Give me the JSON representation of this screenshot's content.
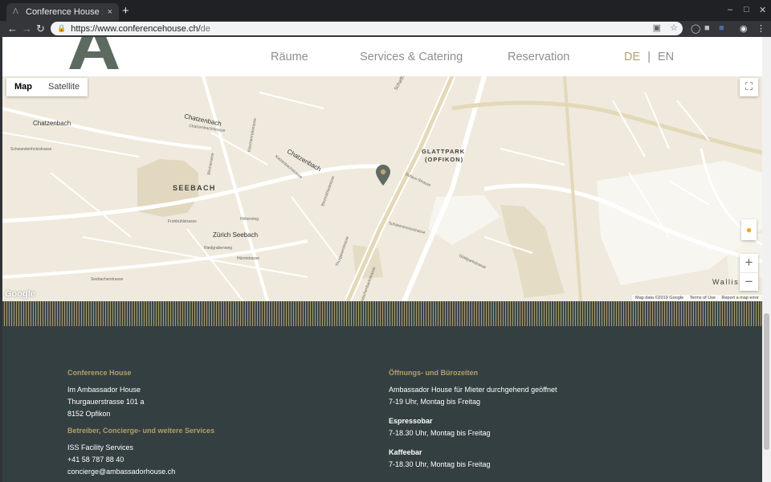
{
  "browser": {
    "tab_title": "Conference House : Ambass",
    "tab_close": "×",
    "new_tab": "+",
    "url_host": "https://www.conferencehouse.ch/",
    "url_path": "de",
    "window_min": "–",
    "window_max": "□",
    "window_close": "✕"
  },
  "header": {
    "logo_letter": "A",
    "nav": [
      "Räume",
      "Services & Catering",
      "Reservation"
    ],
    "lang_active": "DE",
    "lang_separator": "|",
    "lang_other": "EN"
  },
  "map": {
    "type_map": "Map",
    "type_satellite": "Satellite",
    "zoom_in": "+",
    "zoom_out": "−",
    "google_logo": "Google",
    "attribution": "Map data ©2019 Google",
    "terms": "Terms of Use",
    "report": "Report a map error",
    "labels": {
      "seebach": "SEEBACH",
      "glattpark_1": "GLATTPARK",
      "glattpark_2": "(OPFIKON)",
      "chatzenbach_left": "Chatzenbach",
      "chatzenbach_mid": "Chatzenbach",
      "chatzenbach_center": "Chatzenbach",
      "zuerich_seebach": "Zürich Seebach",
      "wallisellen": "Wallis",
      "schaffhauserstrasse": "Schaffha",
      "streets": [
        "Schwandenholzstrasse",
        "Chatzenbachstrasse",
        "Dufaux-Strasse",
        "Glattparkstrasse",
        "Schärenmoosstrasse",
        "Thurgauerstrasse",
        "Leutschenbachstrasse",
        "Hürststrasse",
        "Binzmühlestrasse",
        "Riedgrabenweg",
        "Frohbühlstrasse",
        "Birchstrasse",
        "Köschenrütistrasse",
        "Katzenbachstrasse",
        "Höhenring",
        "Seebacherstrasse"
      ]
    }
  },
  "footer": {
    "col1": {
      "heading": "Conference House",
      "lines": [
        "Im Ambassador House",
        "Thurgauerstrasse 101 a",
        "8152 Opfikon"
      ],
      "heading2": "Betreiber, Concierge- und weitere Services",
      "lines2": [
        "ISS Facility Services",
        "+41 58 787 88 40",
        "concierge@ambassadorhouse.ch"
      ]
    },
    "col2": {
      "heading": "Öffnungs- und Bürozeiten",
      "lines": [
        "Ambassador House für Mieter durchgehend geöffnet",
        "7-19 Uhr, Montag bis Freitag"
      ],
      "espresso_title": "Espressobar",
      "espresso_hours": "7-18.30 Uhr, Montag bis Freitag",
      "kaffee_title": "Kaffeebar",
      "kaffee_hours": "7-18.30 Uhr, Montag bis Freitag"
    }
  },
  "colors": {
    "accent_gold": "#b7a069",
    "footer_bg": "#343f42",
    "map_bg": "#efeadd",
    "marker": "#5f6a62"
  },
  "icons": [
    "back-arrow-icon",
    "forward-arrow-icon",
    "reload-icon",
    "lock-icon",
    "translate-icon",
    "star-icon",
    "profile-icon",
    "menu-icon",
    "fullscreen-icon",
    "pegman-icon",
    "map-marker-icon"
  ]
}
